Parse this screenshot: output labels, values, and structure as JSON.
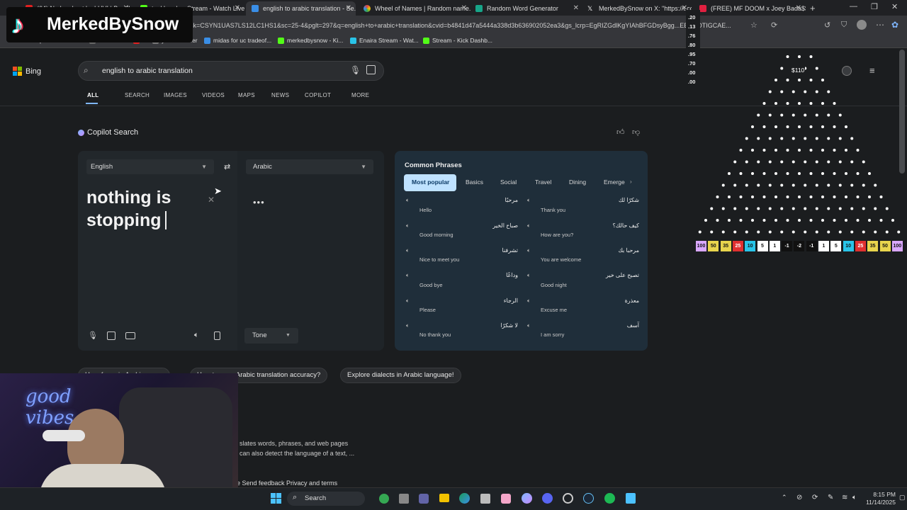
{
  "browser": {
    "tabs": [
      {
        "label": "(64) No Luv Lost by LUV! | BandL...",
        "color": "#e02020"
      },
      {
        "label": "tankbomber Stream - Watch Live",
        "color": "#53fc18"
      },
      {
        "label": "english to arabic translation - Se...",
        "color": "#3a8ee6"
      },
      {
        "label": "Wheel of Names | Random name...",
        "color": "#e04444"
      },
      {
        "label": "Random Word Generator",
        "color": "#17a589"
      },
      {
        "label": "MerkedBySnow on X: \"https://t.co...",
        "color": "#ffffff"
      },
      {
        "label": "(FREE) MF DOOM x Joey Bada$$",
        "color": "#e02040"
      }
    ],
    "url": "sk=CSYN1UAS7LS12LC1HS1&sc=25-4&pglt=297&q=english+to+arabic+translation&cvid=b4841d47a5444a338d3b636902052ea3&gs_lcrp=EgRIZGdlKgYIAhBFGDsyBgg...EEUYOTIGCAE...",
    "bookmarks": [
      "port favorites",
      "Thank You",
      "i",
      "ytdownloader",
      "midas for uc tradeof...",
      "merkedbysnow - Ki...",
      "Enaira Stream - Wat...",
      "Stream - Kick Dashb..."
    ]
  },
  "bing": {
    "logo": "Bing",
    "query": "english to arabic translation",
    "nav": [
      "ALL",
      "SEARCH",
      "IMAGES",
      "VIDEOS",
      "MAPS",
      "NEWS",
      "COPILOT",
      "MORE"
    ],
    "copilot_title": "Copilot Search",
    "translator": {
      "from": "English",
      "to": "Arabic",
      "source_text_1": "nothing is",
      "source_text_2": "stopping",
      "dots": "•••",
      "tone": "Tone"
    },
    "phrases": {
      "title": "Common Phrases",
      "tabs": [
        "Most popular",
        "Basics",
        "Social",
        "Travel",
        "Dining",
        "Emerge"
      ],
      "items": [
        {
          "en": "Hello",
          "ar": "مرحبًا"
        },
        {
          "en": "Thank you",
          "ar": "شكرًا لك"
        },
        {
          "en": "Good morning",
          "ar": "صباح الخير"
        },
        {
          "en": "How are you?",
          "ar": "كيف حالك؟"
        },
        {
          "en": "Nice to meet you",
          "ar": "تشرفنا"
        },
        {
          "en": "You are welcome",
          "ar": "مرحبا بك"
        },
        {
          "en": "Good bye",
          "ar": "وداعًا"
        },
        {
          "en": "Good night",
          "ar": "تصبح على خير"
        },
        {
          "en": "Please",
          "ar": "الرجاء"
        },
        {
          "en": "Excuse me",
          "ar": "معذرة"
        },
        {
          "en": "No thank you",
          "ar": "لا شكرًا"
        },
        {
          "en": "I am sorry",
          "ar": "آسف"
        }
      ]
    },
    "chips": [
      "Ho... for ... in Arabic ... e...",
      "How to ... ve Arabic translation accuracy?",
      "Explore dialects in Arabic language!"
    ],
    "snippet_1": "slates words, phrases, and web pages",
    "snippet_2": "can also detect the language of a text, ...",
    "feedback": "e Send feedback Privacy and terms"
  },
  "overlay": {
    "tiktok_name": "MerkedBySnow",
    "ticker": [
      ".20",
      ".13",
      ".76",
      ".80",
      ".95",
      ".70",
      ".00",
      ".00"
    ],
    "counter": "$110",
    "webcam_text": "good vibes"
  },
  "plinko": {
    "slots": [
      {
        "v": "100",
        "c": "#d9a7ff"
      },
      {
        "v": "50",
        "c": "#e8d44d"
      },
      {
        "v": "35",
        "c": "#e8d44d"
      },
      {
        "v": "25",
        "c": "#e03030"
      },
      {
        "v": "10",
        "c": "#29c4e8"
      },
      {
        "v": "5",
        "c": "#ffffff"
      },
      {
        "v": "1",
        "c": "#ffffff"
      },
      {
        "v": "-1",
        "c": "#111111"
      },
      {
        "v": "-2",
        "c": "#111111"
      },
      {
        "v": "-1",
        "c": "#111111"
      },
      {
        "v": "1",
        "c": "#ffffff"
      },
      {
        "v": "5",
        "c": "#ffffff"
      },
      {
        "v": "10",
        "c": "#29c4e8"
      },
      {
        "v": "25",
        "c": "#e03030"
      },
      {
        "v": "35",
        "c": "#e8d44d"
      },
      {
        "v": "50",
        "c": "#e8d44d"
      },
      {
        "v": "100",
        "c": "#d9a7ff"
      }
    ]
  },
  "taskbar": {
    "search": "Search",
    "time": "8:15 PM",
    "date": "11/14/2025"
  }
}
